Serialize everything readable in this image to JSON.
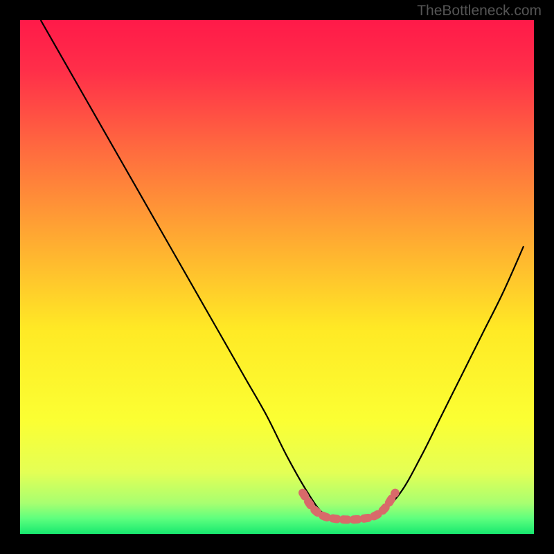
{
  "watermark": "TheBottleneck.com",
  "chart_data": {
    "type": "line",
    "title": "",
    "xlabel": "",
    "ylabel": "",
    "xlim": [
      0,
      100
    ],
    "ylim": [
      0,
      100
    ],
    "series": [
      {
        "name": "bottleneck-curve",
        "x": [
          4,
          8,
          12,
          16,
          20,
          24,
          28,
          32,
          36,
          40,
          44,
          48,
          52,
          56,
          59,
          62,
          66,
          70,
          74,
          78,
          82,
          86,
          90,
          94,
          98
        ],
        "values": [
          100,
          93,
          86,
          79,
          72,
          65,
          58,
          51,
          44,
          37,
          30,
          23,
          15,
          8,
          4,
          3,
          3,
          4,
          8,
          15,
          23,
          31,
          39,
          47,
          56
        ]
      }
    ],
    "highlight": {
      "name": "optimal-range-marker",
      "x": [
        55,
        57,
        59,
        61,
        63,
        65,
        67,
        69,
        71,
        73
      ],
      "values": [
        8,
        5,
        3.5,
        3,
        2.8,
        2.8,
        3,
        3.5,
        5,
        8
      ]
    },
    "gradient_stops": [
      {
        "pos": 0.0,
        "color": "#ff1a49"
      },
      {
        "pos": 0.1,
        "color": "#ff2f49"
      },
      {
        "pos": 0.25,
        "color": "#ff6a3f"
      },
      {
        "pos": 0.45,
        "color": "#ffb330"
      },
      {
        "pos": 0.6,
        "color": "#ffe925"
      },
      {
        "pos": 0.78,
        "color": "#fbff33"
      },
      {
        "pos": 0.88,
        "color": "#e4ff55"
      },
      {
        "pos": 0.94,
        "color": "#a8ff70"
      },
      {
        "pos": 0.97,
        "color": "#5eff7e"
      },
      {
        "pos": 1.0,
        "color": "#17e86f"
      }
    ]
  }
}
